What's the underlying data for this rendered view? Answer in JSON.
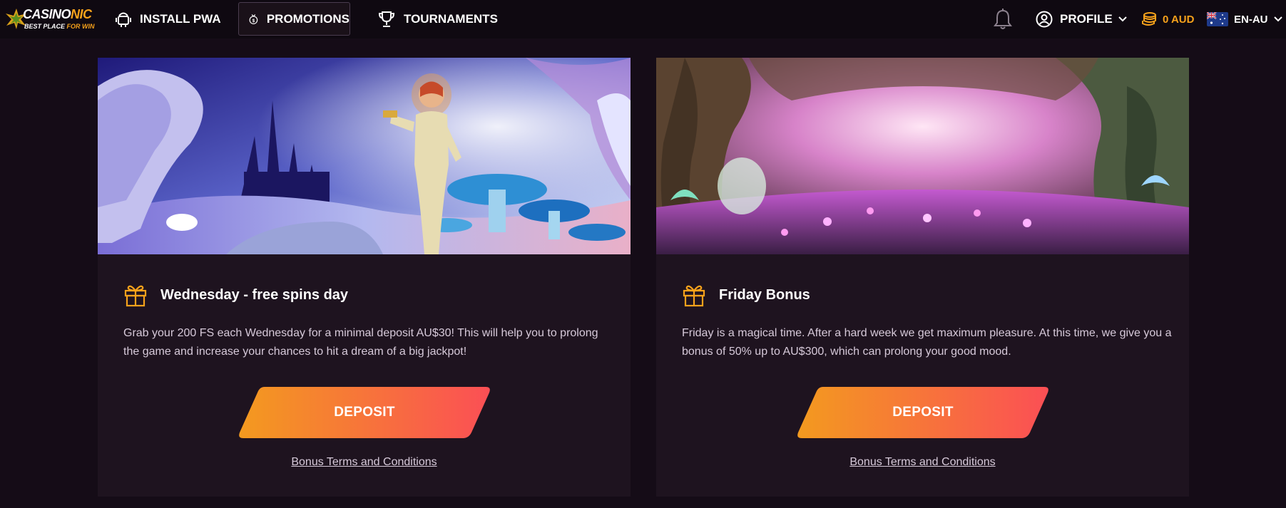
{
  "header": {
    "logo": {
      "brand_main": "CASINO",
      "brand_accent": "NIC",
      "tagline_main": "BEST PLACE ",
      "tagline_accent": "FOR WIN"
    },
    "nav": {
      "install_pwa": "INSTALL PWA",
      "promotions": "PROMOTIONS",
      "tournaments": "TOURNAMENTS"
    },
    "notifications_icon": "bell-icon",
    "profile_label": "PROFILE",
    "balance": "0 AUD",
    "language": "EN-AU"
  },
  "promotions": [
    {
      "title": "Wednesday - free spins day",
      "description": "Grab your 200 FS each Wednesday for a minimal deposit AU$30! This will help you to prolong the game and increase your chances to hit a dream of a big jackpot!",
      "button_label": "DEPOSIT",
      "terms_label": "Bonus Terms and Conditions",
      "icon": "gift-icon"
    },
    {
      "title": "Friday Bonus",
      "description": "Friday is a magical time. After a hard week we get maximum pleasure. At this time, we give you a bonus of 50% up to AU$300, which can prolong your good mood.",
      "button_label": "DEPOSIT",
      "terms_label": "Bonus Terms and Conditions",
      "icon": "gift-icon"
    }
  ],
  "colors": {
    "background": "#150c17",
    "header": "#0f0911",
    "card": "#1e131f",
    "accent_orange": "#f7a21b",
    "button_gradient_start": "#f39a1f",
    "button_gradient_end": "#fb4f55"
  }
}
